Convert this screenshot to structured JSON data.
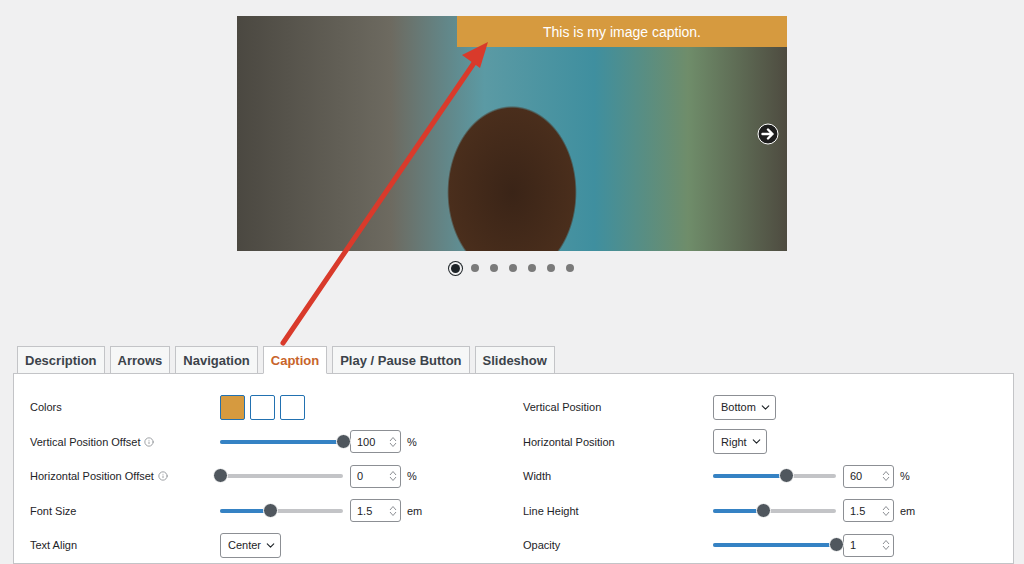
{
  "slider": {
    "caption": "This is my image caption.",
    "slides": [
      {
        "selected": true
      },
      {
        "selected": false
      },
      {
        "selected": false
      },
      {
        "selected": false
      },
      {
        "selected": false
      },
      {
        "selected": false
      },
      {
        "selected": false
      }
    ]
  },
  "tabs": [
    {
      "label": "Description",
      "selected": false
    },
    {
      "label": "Arrows",
      "selected": false
    },
    {
      "label": "Navigation",
      "selected": false
    },
    {
      "label": "Caption",
      "selected": true
    },
    {
      "label": "Play / Pause Button",
      "selected": false
    },
    {
      "label": "Slideshow",
      "selected": false
    }
  ],
  "settings_left": [
    {
      "kind": "colors",
      "label": "Colors",
      "info": false,
      "swatches": [
        {
          "color": "#d69a3f"
        },
        {
          "color": "#ffffff"
        },
        {
          "color": "#ffffff"
        }
      ]
    },
    {
      "kind": "slider",
      "label": "Vertical Position Offset",
      "info": true,
      "level": 1,
      "value": "100",
      "unit": "%"
    },
    {
      "kind": "slider",
      "label": "Horizontal Position Offset",
      "info": true,
      "level": 0,
      "value": "0",
      "unit": "%"
    },
    {
      "kind": "slider",
      "label": "Font Size",
      "info": false,
      "level": 0.41,
      "value": "1.5",
      "unit": "em"
    },
    {
      "kind": "select",
      "label": "Text Align",
      "info": false,
      "value": "Center"
    }
  ],
  "settings_right": [
    {
      "kind": "select",
      "label": "Vertical Position",
      "info": false,
      "value": "Bottom"
    },
    {
      "kind": "select",
      "label": "Horizontal Position",
      "info": false,
      "value": "Right"
    },
    {
      "kind": "slider",
      "label": "Width",
      "info": false,
      "level": 0.59,
      "value": "60",
      "unit": "%"
    },
    {
      "kind": "slider",
      "label": "Line Height",
      "info": false,
      "level": 0.41,
      "value": "1.5",
      "unit": "em"
    },
    {
      "kind": "slider",
      "label": "Opacity",
      "info": false,
      "level": 1,
      "value": "1",
      "unit": ""
    }
  ]
}
